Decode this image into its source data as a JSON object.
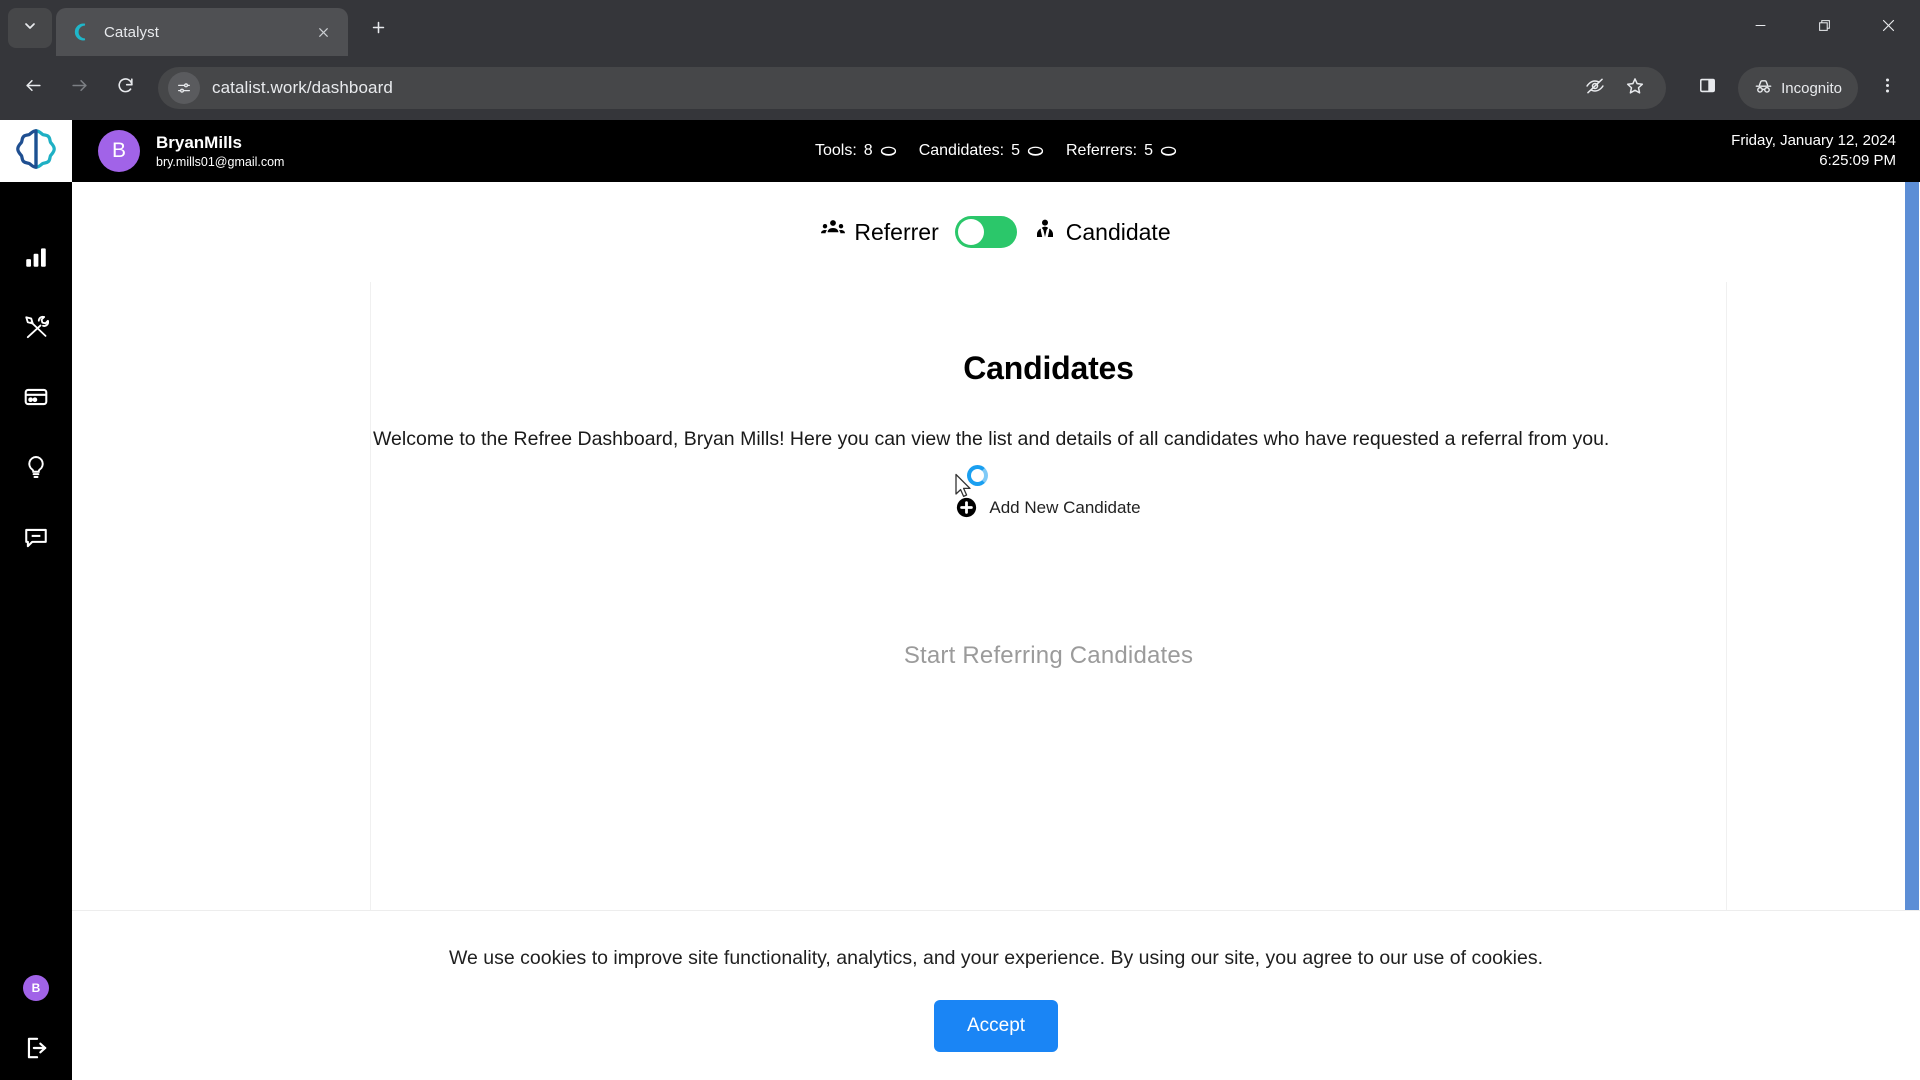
{
  "browser": {
    "tab": {
      "title": "Catalyst",
      "favicon_icon": "catalyst-logo-icon"
    },
    "tab_search_icon": "chevron-down-icon",
    "new_tab_icon": "plus-icon",
    "window": {
      "minimize_icon": "minimize-icon",
      "maximize_icon": "restore-icon",
      "close_icon": "close-icon"
    },
    "nav": {
      "back_icon": "arrow-left-icon",
      "forward_icon": "arrow-right-icon",
      "reload_icon": "reload-icon"
    },
    "omnibox": {
      "site_info_icon": "tune-icon",
      "url": "catalist.work/dashboard",
      "placeholder": "Search Google or type a URL",
      "tracking_icon": "eye-off-icon",
      "bookmark_icon": "star-icon"
    },
    "side_panel_icon": "side-panel-icon",
    "incognito": {
      "label": "Incognito",
      "icon": "incognito-icon"
    },
    "menu_icon": "kebab-menu-icon"
  },
  "rail": {
    "logo_icon": "catalyst-petal-logo-icon",
    "items": [
      {
        "name": "analytics",
        "icon": "bar-chart-icon"
      },
      {
        "name": "tools",
        "icon": "tools-icon"
      },
      {
        "name": "billing",
        "icon": "credit-card-icon"
      },
      {
        "name": "insights",
        "icon": "lightbulb-icon"
      },
      {
        "name": "messages",
        "icon": "chat-icon"
      }
    ],
    "avatar_initial": "B",
    "logout_icon": "logout-icon"
  },
  "appbar": {
    "avatar_initial": "B",
    "user_name": "BryanMills",
    "user_email": "bry.mills01@gmail.com",
    "stats": [
      {
        "label": "Tools:",
        "value": "8",
        "icon": "coin-icon"
      },
      {
        "label": "Candidates:",
        "value": "5",
        "icon": "coin-icon"
      },
      {
        "label": "Referrers:",
        "value": "5",
        "icon": "coin-icon"
      }
    ],
    "date": "Friday, January 12, 2024",
    "time": "6:25:09 PM"
  },
  "toggle": {
    "left_label": "Referrer",
    "left_icon": "group-people-icon",
    "right_label": "Candidate",
    "right_icon": "person-tie-icon",
    "state": "left",
    "track_color": "#2bc76a"
  },
  "main": {
    "title": "Candidates",
    "welcome": "Welcome to the Refree Dashboard, Bryan Mills! Here you can view the list and details of all candidates who have requested a referral from you.",
    "add_label": "Add New Candidate",
    "add_icon": "plus-circle-icon",
    "loading_icon": "loading-spinner-icon",
    "cursor_icon": "mouse-pointer-icon",
    "empty_state": "Start Referring Candidates"
  },
  "cookie": {
    "message": "We use cookies to improve site functionality, analytics, and your experience. By using our site, you agree to our use of cookies.",
    "accept_label": "Accept",
    "accept_color": "#1a85f5"
  }
}
